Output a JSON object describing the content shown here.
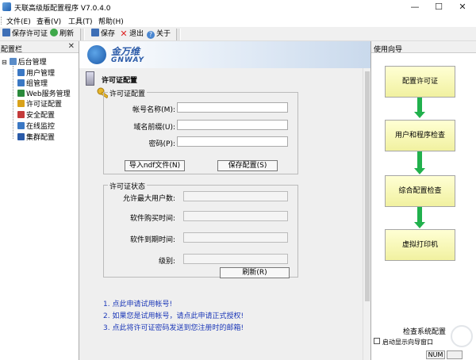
{
  "window": {
    "title": "天联高级版配置程序 V7.0.4.0",
    "minimize": "—",
    "maximize": "☐",
    "close": "✕"
  },
  "menu": {
    "file": "文件(E)",
    "view": "查看(V)",
    "tools": "工具(T)",
    "help": "帮助(H)"
  },
  "toolbar": {
    "save_license": "保存许可证",
    "refresh": "刷新",
    "save": "保存",
    "exit": "退出",
    "about": "关于"
  },
  "left_panel": {
    "title": "配置栏",
    "close": "✕",
    "root": "后台管理",
    "items": [
      {
        "label": "用户管理",
        "icon": "users-icon",
        "color": "#3b78c4"
      },
      {
        "label": "组管理",
        "icon": "group-icon",
        "color": "#3b78c4"
      },
      {
        "label": "Web服务管理",
        "icon": "web-icon",
        "color": "#2a8a3b"
      },
      {
        "label": "许可证配置",
        "icon": "key-icon",
        "color": "#d9a21a"
      },
      {
        "label": "安全配置",
        "icon": "shield-icon",
        "color": "#c43b3b"
      },
      {
        "label": "在线监控",
        "icon": "monitor-icon",
        "color": "#3b78c4"
      },
      {
        "label": "集群配置",
        "icon": "cluster-icon",
        "color": "#2a5aa8"
      }
    ]
  },
  "logo": {
    "cn": "金万维",
    "en": "GNWAY"
  },
  "license": {
    "section_title": "许可证配置",
    "config_group": "许可证配置",
    "account_label": "帐号名称(M):",
    "account_value": "",
    "prefix_label": "域名前缀(U):",
    "prefix_value": "",
    "password_label": "密码(P):",
    "password_value": "",
    "import_button": "导入ndf文件(N)",
    "save_button": "保存配置(S)",
    "status_group": "许可证状态",
    "max_users_label": "允许最大用户数:",
    "purchase_time_label": "软件购买时间:",
    "expire_time_label": "软件到期时间:",
    "level_label": "级别:",
    "refresh_button": "刷新(R)"
  },
  "notes": [
    "1. 点此申请试用帐号!",
    "2. 如果您是试用帐号，请点此申请正式授权!",
    "3. 点此将许可证密码发送到您注册时的邮箱!"
  ],
  "wizard": {
    "title": "使用向导",
    "steps": [
      "配置许可证",
      "用户和程序检查",
      "综合配置检查",
      "虚拟打印机"
    ],
    "check_config": "检查系统配置",
    "startup_show": "启动显示向导窗口"
  },
  "status": {
    "num": "NUM"
  },
  "colors": {
    "arrow": "#21b14d",
    "note_text": "#1c38b8",
    "flow_box": "#f1f1a0"
  }
}
